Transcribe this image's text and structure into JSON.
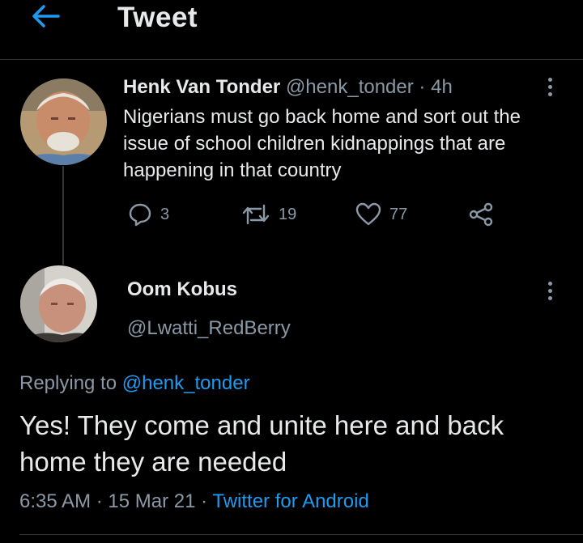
{
  "header": {
    "title": "Tweet"
  },
  "tweet": {
    "author_name": "Henk Van Tonder",
    "author_handle": "@henk_tonder",
    "separator": "·",
    "time_ago": "4h",
    "text": "Nigerians must go back home and sort out the issue of school children kidnappings that are happening in that country",
    "replies": "3",
    "retweets": "19",
    "likes": "77"
  },
  "reply": {
    "author_name": "Oom Kobus",
    "author_handle": "@Lwatti_RedBerry",
    "replying_prefix": "Replying to",
    "replying_to": "@henk_tonder",
    "text": "Yes! They come and unite here and back home they are needed",
    "time": "6:35 AM",
    "separator": "·",
    "date": "15 Mar 21",
    "source": "Twitter for Android"
  },
  "colors": {
    "accent": "#1d9bf0",
    "muted": "#8b98a5",
    "background": "#000000"
  },
  "icons": [
    "back-arrow-icon",
    "more-vertical-icon",
    "reply-icon",
    "retweet-icon",
    "like-icon",
    "share-icon"
  ]
}
